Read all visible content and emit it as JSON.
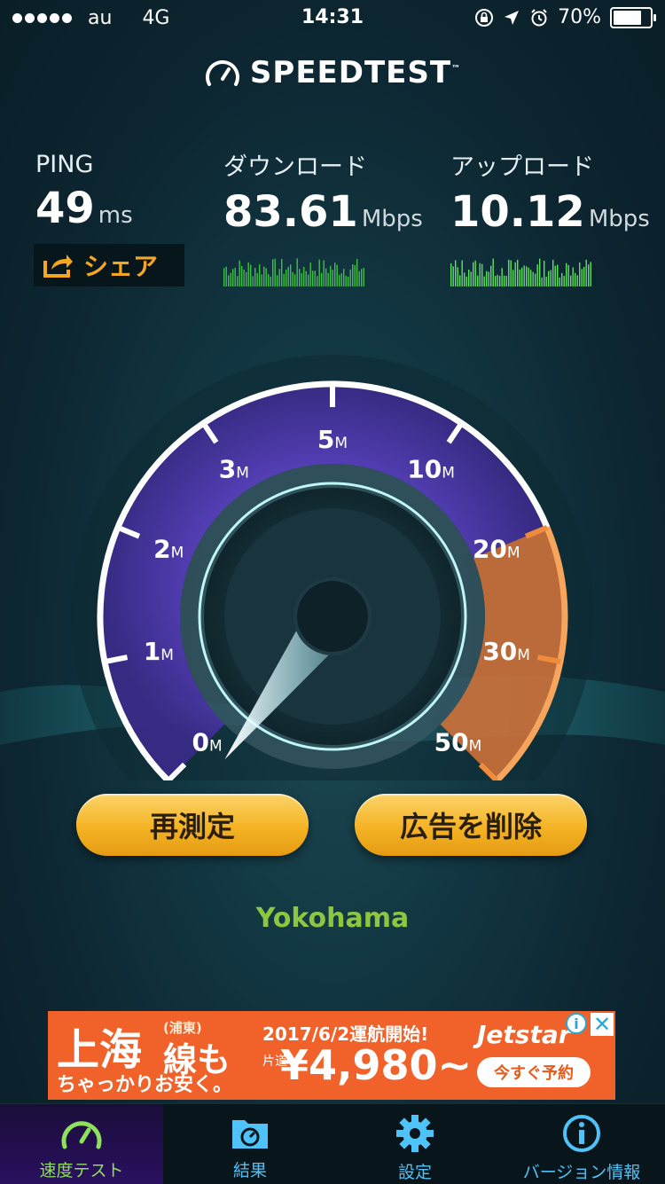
{
  "status_bar": {
    "carrier": "au",
    "network": "4G",
    "time": "14:31",
    "battery": "70%",
    "battery_level": 0.7
  },
  "app": {
    "title": "SPEEDTEST",
    "trademark": "™"
  },
  "metrics": {
    "ping": {
      "label": "PING",
      "value": "49",
      "unit": "ms"
    },
    "download": {
      "label": "ダウンロード",
      "value": "83.61",
      "unit": "Mbps"
    },
    "upload": {
      "label": "アップロード",
      "value": "10.12",
      "unit": "Mbps"
    }
  },
  "share": {
    "label": "シェア",
    "icon": "share-icon"
  },
  "gauge": {
    "ticks": [
      {
        "num": "0",
        "unit": "M"
      },
      {
        "num": "1",
        "unit": "M"
      },
      {
        "num": "2",
        "unit": "M"
      },
      {
        "num": "3",
        "unit": "M"
      },
      {
        "num": "5",
        "unit": "M"
      },
      {
        "num": "10",
        "unit": "M"
      },
      {
        "num": "20",
        "unit": "M"
      },
      {
        "num": "30",
        "unit": "M"
      },
      {
        "num": "50",
        "unit": "M"
      }
    ],
    "colors": {
      "arc": "#6b4fd0",
      "hot": "#f08a3c",
      "rim": "#ffffff",
      "needle": "#b8f4ff"
    }
  },
  "buttons": {
    "retest": "再測定",
    "remove_ads": "広告を削除"
  },
  "location": "Yokohama",
  "ad": {
    "headline": "上海",
    "sub": "(浦東)",
    "line2": "線も",
    "line3": "ちゃっかりお安く。",
    "date": "2017/6/2運航開始!",
    "price_prefix": "片道",
    "price": "¥4,980~",
    "brand": "Jetstar",
    "cta": "今すぐ予約",
    "info_icon": "i",
    "close_icon": "✕"
  },
  "tabs": [
    {
      "label": "速度テスト",
      "icon": "speedometer-icon",
      "active": true
    },
    {
      "label": "結果",
      "icon": "results-folder-icon",
      "active": false
    },
    {
      "label": "設定",
      "icon": "gear-icon",
      "active": false
    },
    {
      "label": "バージョン情報",
      "icon": "info-icon",
      "active": false
    }
  ],
  "accent_colors": {
    "orange": "#f5a623",
    "green": "#8dc63f",
    "blue": "#4fc3f7"
  }
}
